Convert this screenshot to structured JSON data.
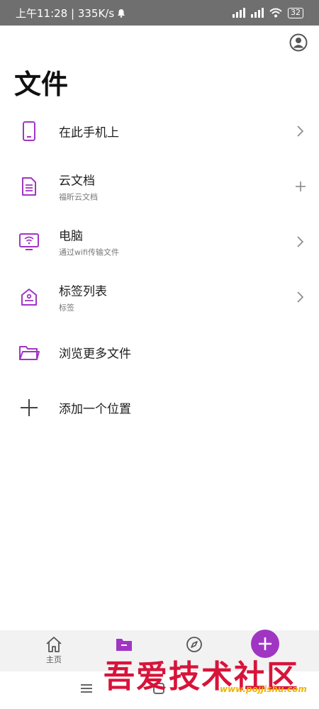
{
  "status_bar": {
    "time_speed": "上午11:28 | 335K/s",
    "battery": "32"
  },
  "page": {
    "title": "文件"
  },
  "locations": [
    {
      "title": "在此手机上",
      "subtitle": "",
      "icon": "phone-icon",
      "trailing": "chevron-right-icon"
    },
    {
      "title": "云文档",
      "subtitle": "福昕云文档",
      "icon": "cloud-document-icon",
      "trailing": "plus-icon"
    },
    {
      "title": "电脑",
      "subtitle": "通过wifi传输文件",
      "icon": "computer-wifi-icon",
      "trailing": "chevron-right-icon"
    },
    {
      "title": "标签列表",
      "subtitle": "标签",
      "icon": "tag-icon",
      "trailing": "chevron-right-icon"
    },
    {
      "title": "浏览更多文件",
      "subtitle": "",
      "icon": "folder-icon",
      "trailing": ""
    },
    {
      "title": "添加一个位置",
      "subtitle": "",
      "icon": "plus-icon",
      "trailing": ""
    }
  ],
  "bottom_nav": {
    "home_label": "主页",
    "active_color": "#a035c4"
  },
  "watermark": {
    "text": "吾爱技术社区",
    "url": "www.pojjishu.com"
  },
  "colors": {
    "accent": "#a035c4",
    "status_bar_bg": "#6f6f6f"
  }
}
